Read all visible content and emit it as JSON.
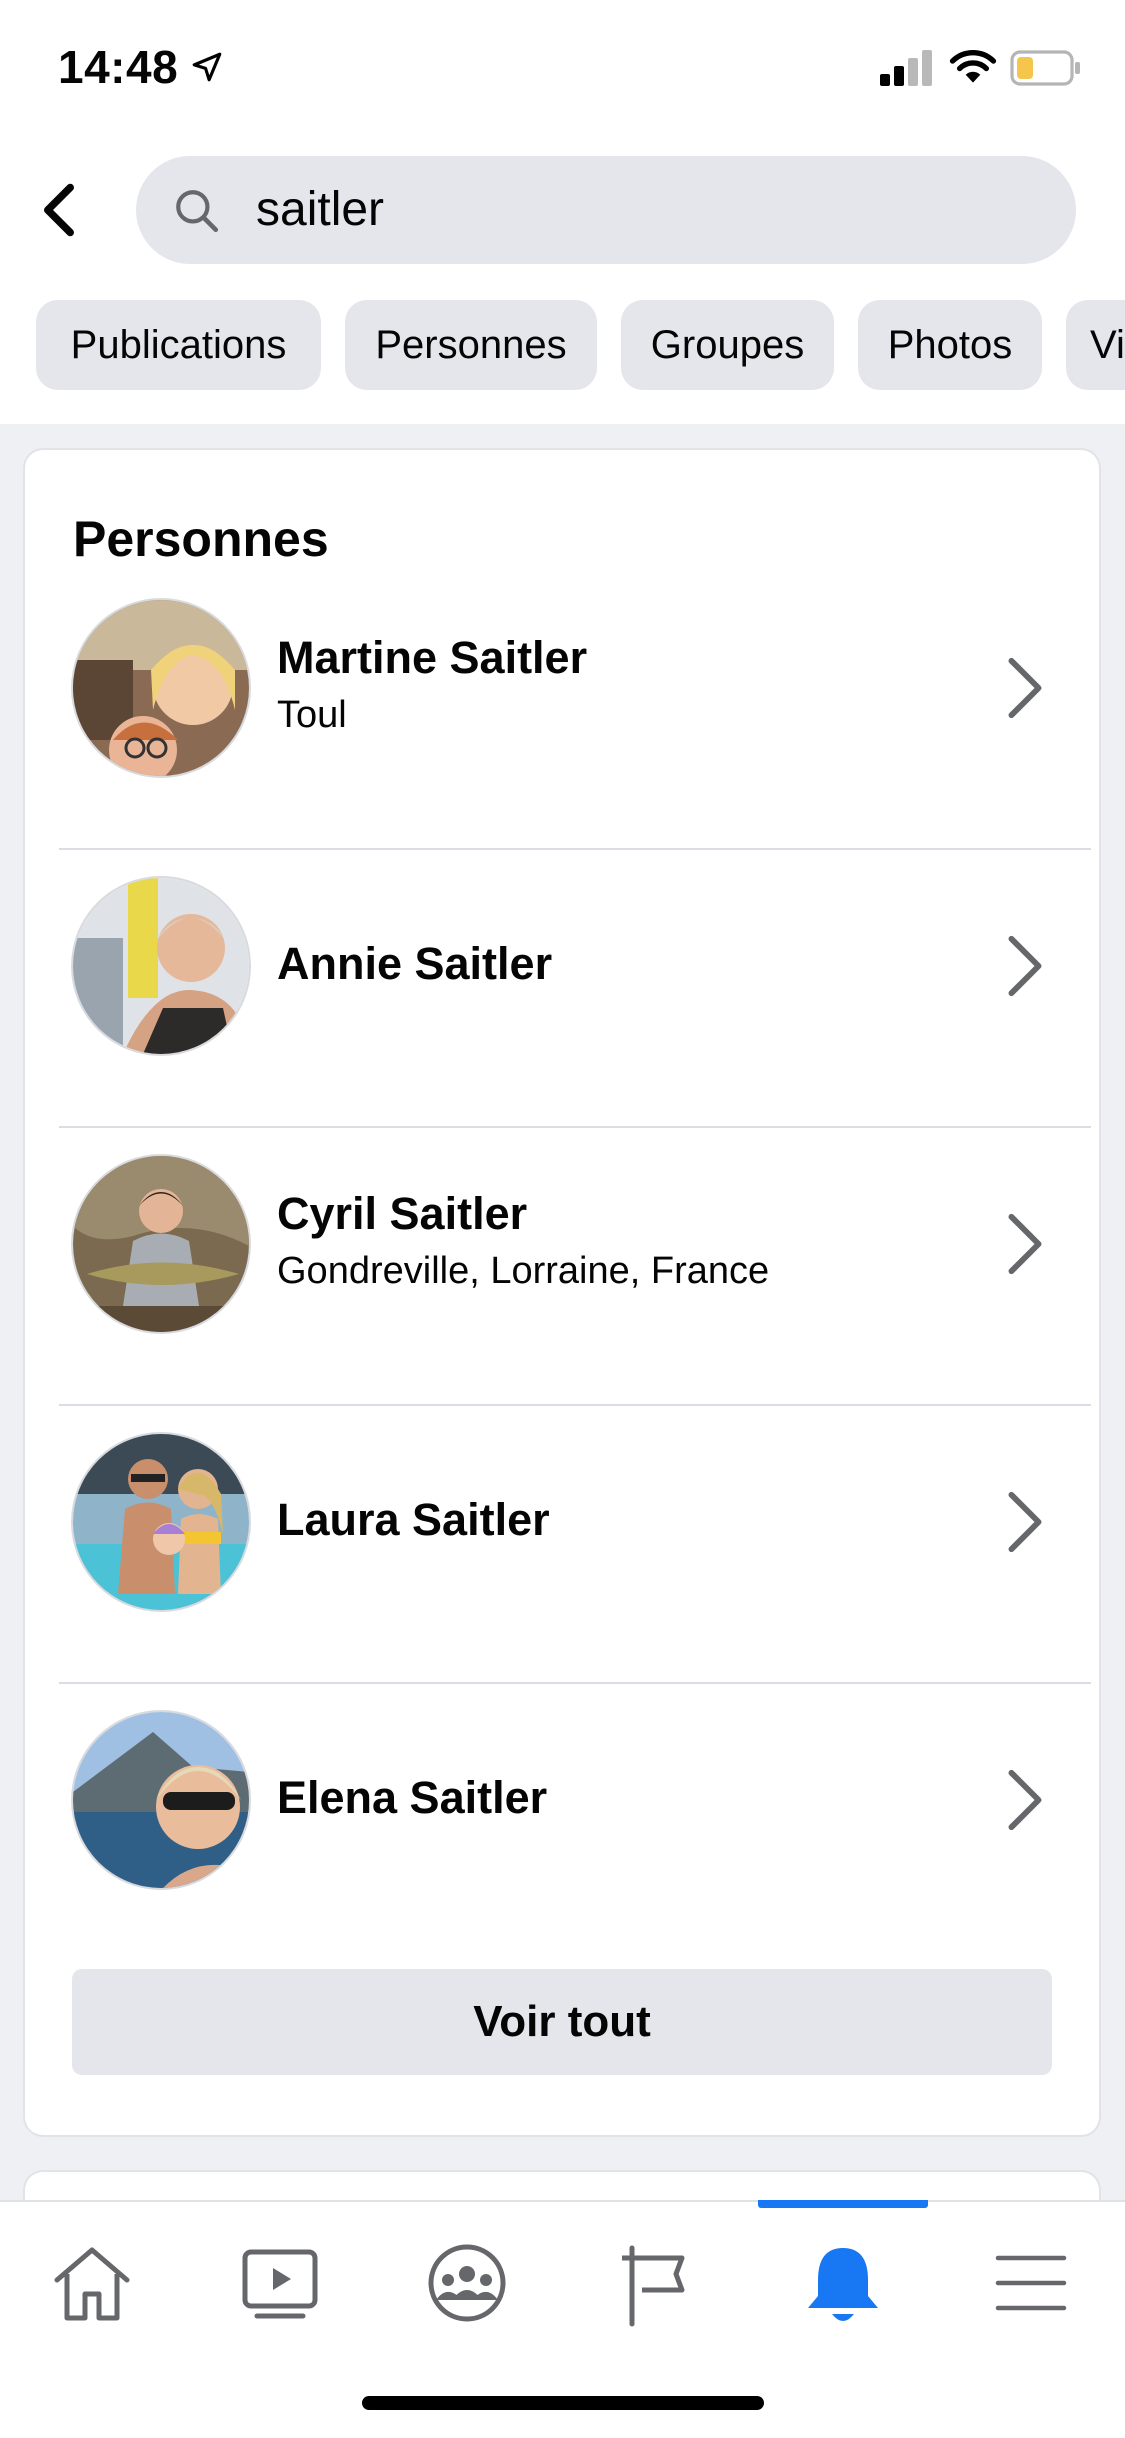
{
  "status_bar": {
    "time": "14:48",
    "icons": [
      "location-arrow-icon",
      "cellular-signal-icon",
      "wifi-icon",
      "battery-icon"
    ],
    "battery_color": "#f5c64b"
  },
  "search": {
    "query": "saitler",
    "icon": "search-icon"
  },
  "filters": [
    {
      "label": "Publications"
    },
    {
      "label": "Personnes"
    },
    {
      "label": "Groupes"
    },
    {
      "label": "Photos"
    },
    {
      "label": "Vi"
    }
  ],
  "people_section": {
    "title": "Personnes",
    "people": [
      {
        "name": "Martine Saitler",
        "subtitle": "Toul"
      },
      {
        "name": "Annie Saitler",
        "subtitle": ""
      },
      {
        "name": "Cyril Saitler",
        "subtitle": "Gondreville, Lorraine, France"
      },
      {
        "name": "Laura Saitler",
        "subtitle": ""
      },
      {
        "name": "Elena Saitler",
        "subtitle": ""
      }
    ],
    "see_all_label": "Voir tout"
  },
  "tab_bar": {
    "tabs": [
      "home-icon",
      "watch-icon",
      "groups-icon",
      "pages-flag-icon",
      "notifications-bell-icon",
      "menu-icon"
    ],
    "active_tab": "notifications-bell-icon",
    "accent_color": "#1877f2"
  }
}
